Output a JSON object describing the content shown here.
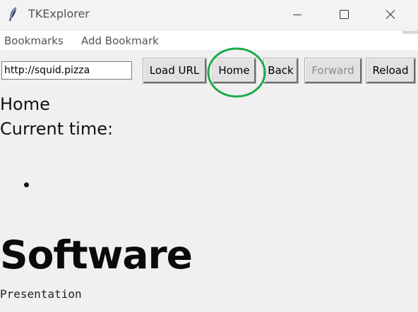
{
  "window": {
    "title": "TKExplorer",
    "icon": "feather-icon",
    "controls": [
      "minimize-icon",
      "maximize-icon",
      "close-icon"
    ]
  },
  "menubar": {
    "items": [
      {
        "label": "Bookmarks"
      },
      {
        "label": "Add Bookmark"
      }
    ]
  },
  "toolbar": {
    "url_value": "http://squid.pizza",
    "load_label": "Load URL",
    "home_label": "Home",
    "back_label": "Back",
    "forward_label": "Forward",
    "forward_disabled": true,
    "reload_label": "Reload",
    "highlight_color": "#1aab4a"
  },
  "page": {
    "title": "Home",
    "time_label": "Current time:",
    "list_items": [
      ""
    ],
    "heading": "Software",
    "subtext": "Presentation"
  }
}
